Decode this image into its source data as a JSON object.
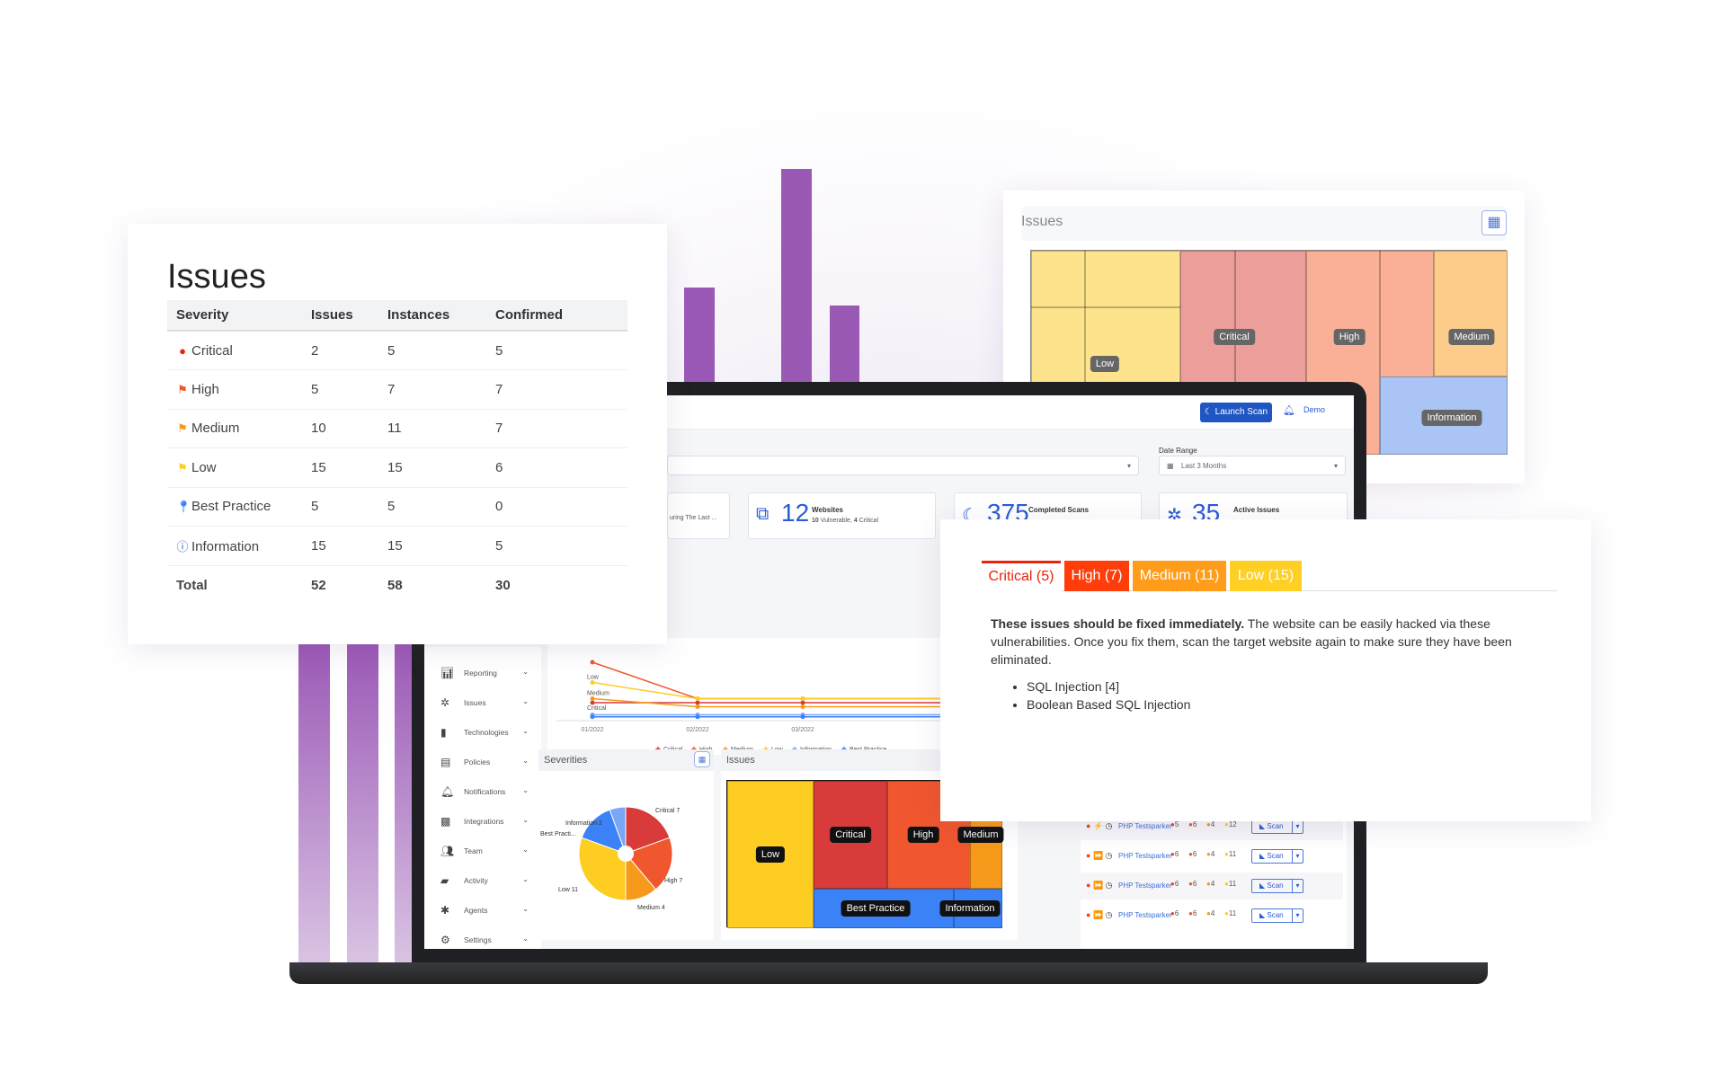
{
  "colors": {
    "brand": "#1f56c2",
    "purple": "#9b59b6",
    "critical": "#d93b3b",
    "high": "#f0572e",
    "medium": "#f79a1b",
    "low": "#fdcd22",
    "best_practice": "#3b82f6",
    "information": "#a9c4f5"
  },
  "issues_card": {
    "title": "Issues",
    "columns": [
      "Severity",
      "Issues",
      "Instances",
      "Confirmed"
    ],
    "rows": [
      {
        "severity": "Critical",
        "icon": "exclamation-circle-icon",
        "color": "#e8230a",
        "issues": "2",
        "instances": "5",
        "confirmed": "5"
      },
      {
        "severity": "High",
        "icon": "flag-icon",
        "color": "#f0572e",
        "issues": "5",
        "instances": "7",
        "confirmed": "7"
      },
      {
        "severity": "Medium",
        "icon": "flag-icon",
        "color": "#f79a1b",
        "issues": "10",
        "instances": "11",
        "confirmed": "7"
      },
      {
        "severity": "Low",
        "icon": "flag-icon",
        "color": "#fdcd22",
        "issues": "15",
        "instances": "15",
        "confirmed": "6"
      },
      {
        "severity": "Best Practice",
        "icon": "map-pin-icon",
        "color": "#3b82f6",
        "issues": "5",
        "instances": "5",
        "confirmed": "0"
      },
      {
        "severity": "Information",
        "icon": "info-circle-icon",
        "color": "#2a5bd7",
        "issues": "15",
        "instances": "15",
        "confirmed": "5"
      }
    ],
    "total": {
      "label": "Total",
      "issues": "52",
      "instances": "58",
      "confirmed": "30"
    }
  },
  "treemap_card": {
    "title": "Issues",
    "labels": {
      "low": "Low",
      "critical": "Critical",
      "high": "High",
      "medium": "Medium",
      "information": "Information"
    }
  },
  "dashboard": {
    "launch_scan": "Launch Scan",
    "user": "Demo",
    "date_range_label": "Date Range",
    "date_range_value": "Last 3 Months",
    "stats": [
      {
        "partial": "uring The Last ..."
      },
      {
        "number": "12",
        "title": "Websites",
        "sub_bold1": "10",
        "sub1": " Vulnerable, ",
        "sub_bold2": "4",
        "sub2": " Critical"
      },
      {
        "number": "375",
        "title": "Completed Scans"
      },
      {
        "number": "35",
        "title": "Active Issues"
      }
    ],
    "sidebar": [
      {
        "label": "Reporting",
        "icon": "bar-chart-icon"
      },
      {
        "label": "Issues",
        "icon": "bug-icon"
      },
      {
        "label": "Technologies",
        "icon": "chip-icon"
      },
      {
        "label": "Policies",
        "icon": "clipboard-icon"
      },
      {
        "label": "Notifications",
        "icon": "bell-icon"
      },
      {
        "label": "Integrations",
        "icon": "puzzle-icon"
      },
      {
        "label": "Team",
        "icon": "team-icon"
      },
      {
        "label": "Activity",
        "icon": "book-icon"
      },
      {
        "label": "Agents",
        "icon": "asterisk-icon"
      },
      {
        "label": "Settings",
        "icon": "gear-icon"
      }
    ],
    "severities_title": "Severities",
    "issues_title": "Issues",
    "treemap_labels": {
      "low": "Low",
      "critical": "Critical",
      "high": "High",
      "medium": "Medium",
      "best_practice": "Best Practice",
      "information": "Information"
    },
    "scan_rows": [
      {
        "name": "PHP Testsparker",
        "badges": [
          "5",
          "6",
          "4",
          "12"
        ],
        "scan": "Scan"
      },
      {
        "name": "PHP Testsparker",
        "badges": [
          "6",
          "6",
          "4",
          "11"
        ],
        "scan": "Scan"
      },
      {
        "name": "PHP Testsparker",
        "badges": [
          "6",
          "6",
          "4",
          "11"
        ],
        "scan": "Scan"
      },
      {
        "name": "PHP Testsparker",
        "badges": [
          "6",
          "6",
          "4",
          "11"
        ],
        "scan": "Scan"
      }
    ]
  },
  "chart_data": [
    {
      "type": "line",
      "categories": [
        "01/2022",
        "02/2022",
        "03/2022"
      ],
      "series": [
        {
          "name": "Critical",
          "color": "#d93b3b",
          "values": [
            4,
            4,
            4
          ]
        },
        {
          "name": "High",
          "color": "#f0572e",
          "values": [
            14,
            5,
            5
          ]
        },
        {
          "name": "Medium",
          "color": "#f79a1b",
          "values": [
            5,
            3,
            3
          ]
        },
        {
          "name": "Low",
          "color": "#fdcd22",
          "values": [
            9,
            5,
            5
          ]
        },
        {
          "name": "Information",
          "color": "#7aa7f5",
          "values": [
            1,
            1,
            1
          ]
        },
        {
          "name": "Best Practice",
          "color": "#3b82f6",
          "values": [
            0.5,
            0.5,
            0.5
          ]
        }
      ],
      "point_labels": [
        "Low",
        "Medium",
        "Critical"
      ],
      "legend": "bottom"
    },
    {
      "type": "pie",
      "title": "Severities",
      "slices": [
        {
          "label": "Critical 7",
          "name": "Critical",
          "value": 7,
          "color": "#d93b3b"
        },
        {
          "label": "High 7",
          "name": "High",
          "value": 7,
          "color": "#f0572e"
        },
        {
          "label": "Medium 4",
          "name": "Medium",
          "value": 4,
          "color": "#f79a1b"
        },
        {
          "label": "Low 11",
          "name": "Low",
          "value": 11,
          "color": "#fdcd22"
        },
        {
          "label": "Best Practi...",
          "name": "Best Practice",
          "value": 5,
          "color": "#3b82f6"
        },
        {
          "label": "Information 2",
          "name": "Information",
          "value": 2,
          "color": "#7aa7f5"
        }
      ]
    }
  ],
  "tabs_card": {
    "tabs": [
      {
        "label": "Critical (5)",
        "color": "#fff"
      },
      {
        "label": "High (7)",
        "color": "#ff3d0a"
      },
      {
        "label": "Medium (11)",
        "color": "#ff9c1a"
      },
      {
        "label": "Low (15)",
        "color": "#ffcf24"
      }
    ],
    "desc_bold": "These issues should be fixed immediately.",
    "desc": " The website can be easily hacked via these vulnerabilities. Once you fix them, scan the target website again to make sure they have been eliminated.",
    "items": [
      "SQL Injection [4]",
      "Boolean Based SQL Injection"
    ]
  }
}
